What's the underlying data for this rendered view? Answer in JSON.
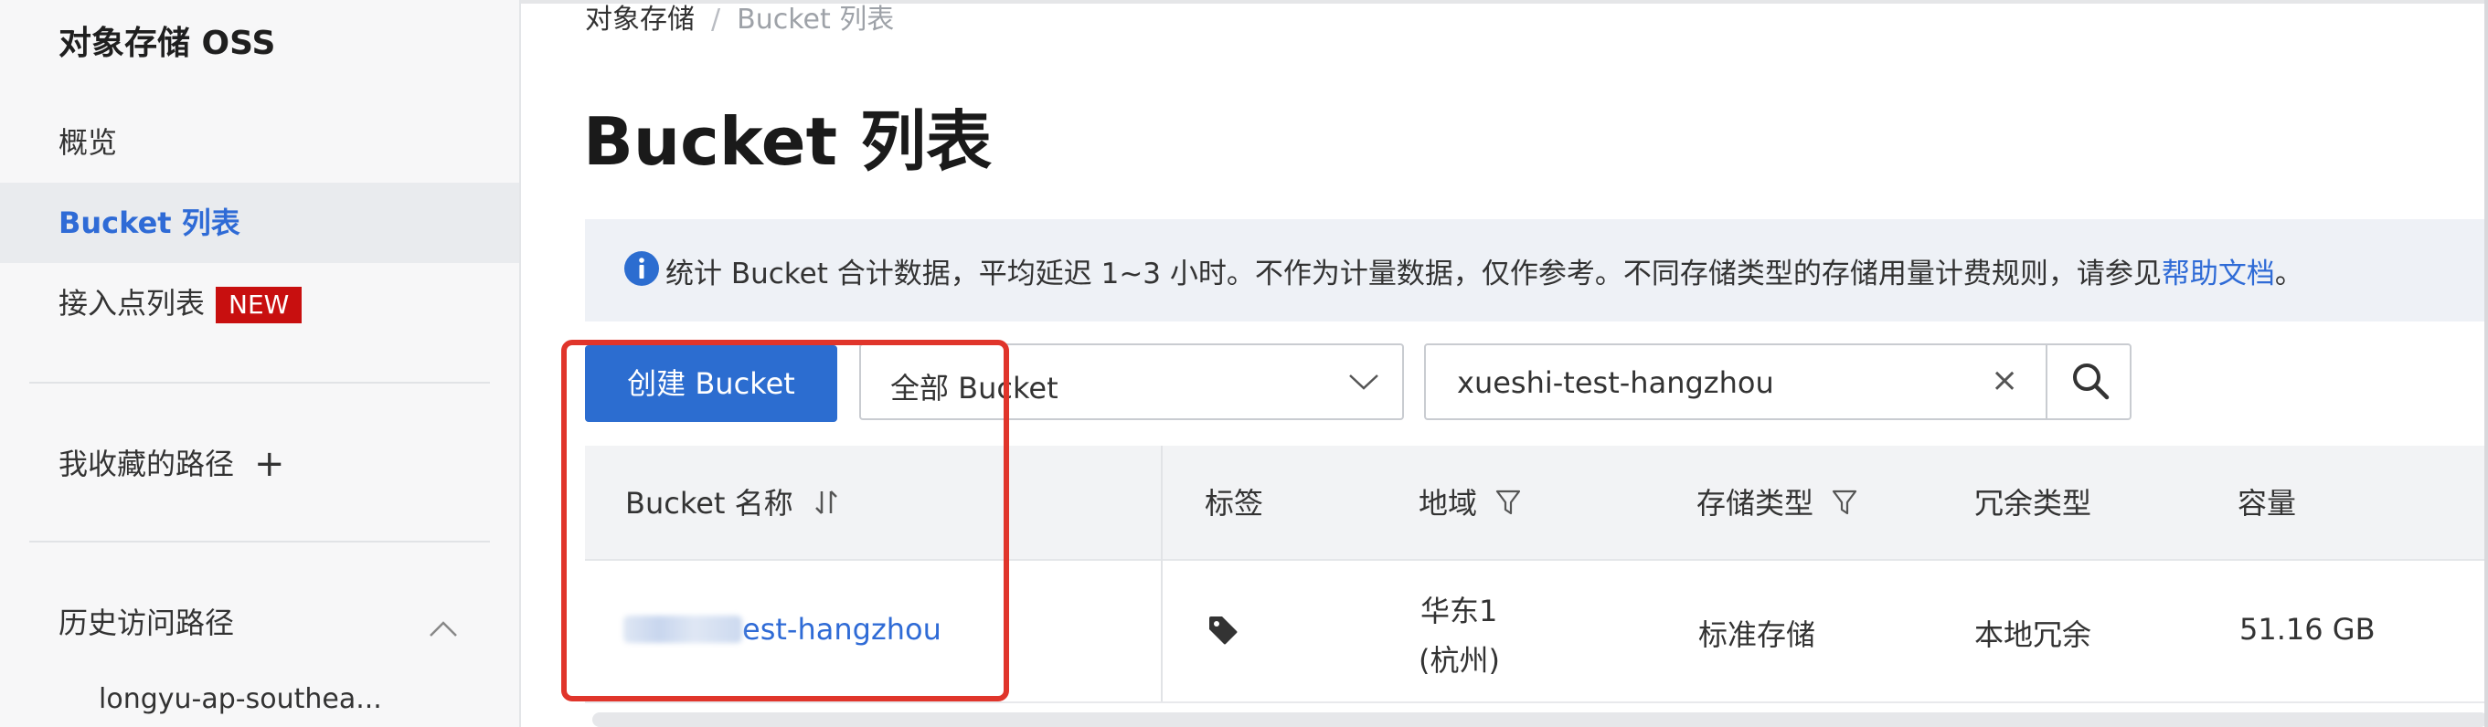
{
  "sidebar": {
    "title": "对象存储 OSS",
    "items": [
      {
        "label": "概览"
      },
      {
        "label": "Bucket 列表"
      },
      {
        "label": "接入点列表",
        "badge": "NEW"
      }
    ],
    "favorites_label": "我收藏的路径",
    "history_label": "历史访问路径",
    "history_items": [
      "longyu-ap-southea..."
    ]
  },
  "breadcrumb": {
    "root": "对象存储",
    "separator": "/",
    "current": "Bucket 列表"
  },
  "page_title": "Bucket 列表",
  "notice": {
    "text": "统计 Bucket 合计数据，平均延迟 1~3 小时。不作为计量数据，仅作参考。不同存储类型的存储用量计费规则，请参见",
    "link": "帮助文档",
    "suffix": "。"
  },
  "toolbar": {
    "create_label": "创建 Bucket",
    "filter_selected": "全部 Bucket",
    "search_value": "xueshi-test-hangzhou",
    "clear_glyph": "×"
  },
  "table": {
    "headers": [
      "Bucket 名称",
      "标签",
      "地域",
      "存储类型",
      "冗余类型",
      "容量"
    ],
    "rows": [
      {
        "name_visible": "est-hangzhou",
        "region_line1": "华东1",
        "region_line2": "(杭州)",
        "storage_type": "标准存储",
        "redundancy": "本地冗余",
        "capacity": "51.16 GB"
      }
    ]
  },
  "colors": {
    "accent": "#2c6dd0",
    "highlight": "#e0352b",
    "badge": "#c80f0f"
  }
}
